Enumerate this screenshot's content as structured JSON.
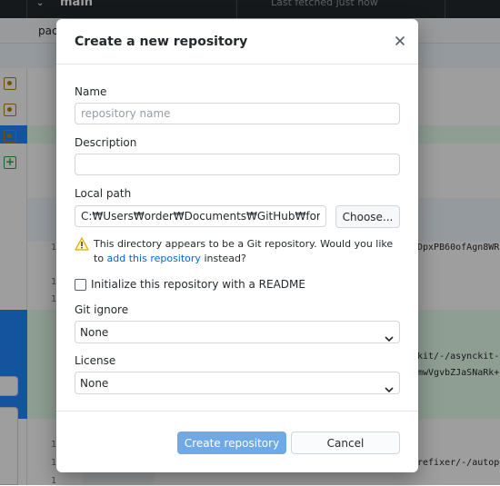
{
  "background": {
    "branch": "main",
    "fetched": "Last fetched just now",
    "tab_label": "pac",
    "line_numbers": [
      "1",
      "1",
      "1",
      "1",
      "1",
      "1"
    ],
    "code_lines": [
      "DpxPB60ofAgn8WR",
      "kit/-/asynckit-",
      "mwVgvbZJaSNaRk+",
      "refixer/-/autop"
    ]
  },
  "dialog": {
    "title": "Create a new repository",
    "name": {
      "label": "Name",
      "placeholder": "repository name",
      "value": ""
    },
    "description": {
      "label": "Description",
      "value": ""
    },
    "local_path": {
      "label": "Local path",
      "value": "C:₩Users₩order₩Documents₩GitHub₩fork",
      "choose_label": "Choose..."
    },
    "warning": {
      "text_before": "This directory appears to be a Git repository. Would you like to",
      "link": "add this repository",
      "text_after": " instead?"
    },
    "readme": {
      "label": "Initialize this repository with a README",
      "checked": false
    },
    "git_ignore": {
      "label": "Git ignore",
      "value": "None"
    },
    "license": {
      "label": "License",
      "value": "None"
    },
    "create_label": "Create repository",
    "cancel_label": "Cancel"
  },
  "colors": {
    "accent": "#0366d6",
    "primary_disabled": "#6ea9e8",
    "warning": "#dbab09",
    "add_green": "#28a745",
    "selected_blue": "#2188ff"
  },
  "icons": [
    "close-icon",
    "warning-icon",
    "chevron-down-icon",
    "file-modified-icon",
    "file-added-icon"
  ]
}
